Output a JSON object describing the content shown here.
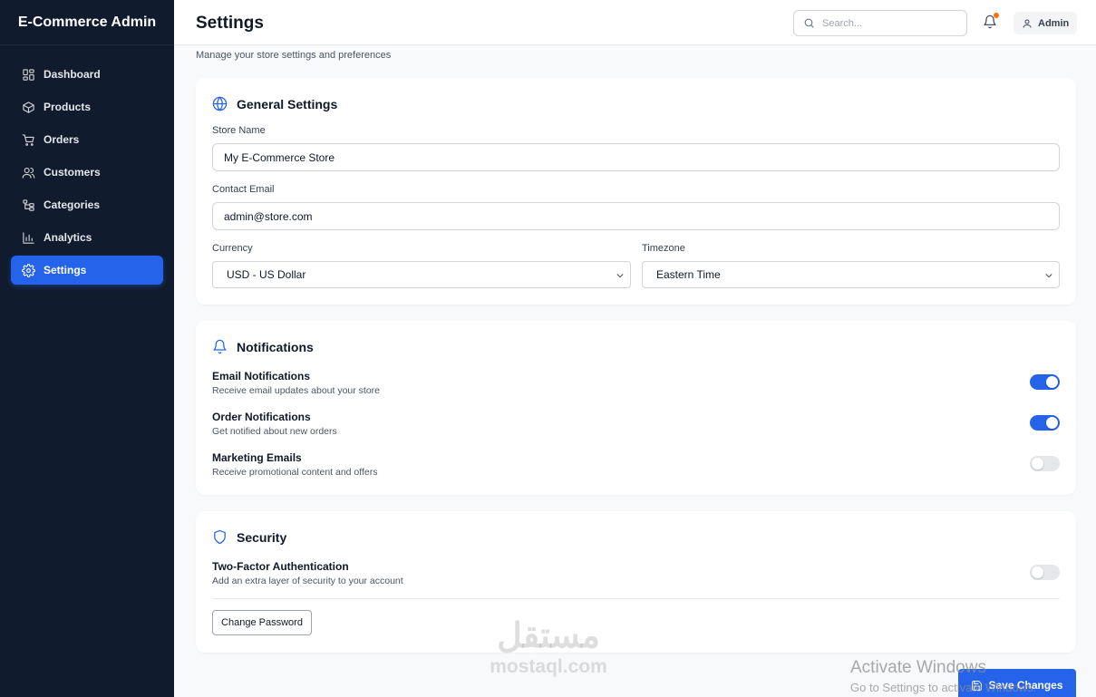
{
  "sidebar": {
    "brand": "E-Commerce Admin",
    "items": [
      {
        "label": "Dashboard",
        "icon": "grid-icon"
      },
      {
        "label": "Products",
        "icon": "box-icon"
      },
      {
        "label": "Orders",
        "icon": "cart-icon"
      },
      {
        "label": "Customers",
        "icon": "users-icon"
      },
      {
        "label": "Categories",
        "icon": "tree-icon"
      },
      {
        "label": "Analytics",
        "icon": "bar-chart-icon"
      },
      {
        "label": "Settings",
        "icon": "gear-icon",
        "active": true
      }
    ]
  },
  "header": {
    "title": "Settings",
    "search_placeholder": "Search...",
    "user_label": "Admin",
    "notification_dot_color": "#f97316"
  },
  "page": {
    "subtitle": "Manage your store settings and preferences"
  },
  "general": {
    "title": "General Settings",
    "store_name_label": "Store Name",
    "store_name_value": "My E-Commerce Store",
    "contact_email_label": "Contact Email",
    "contact_email_value": "admin@store.com",
    "currency_label": "Currency",
    "currency_value": "USD - US Dollar",
    "timezone_label": "Timezone",
    "timezone_value": "Eastern Time"
  },
  "notifications": {
    "title": "Notifications",
    "items": [
      {
        "title": "Email Notifications",
        "desc": "Receive email updates about your store",
        "enabled": true
      },
      {
        "title": "Order Notifications",
        "desc": "Get notified about new orders",
        "enabled": true
      },
      {
        "title": "Marketing Emails",
        "desc": "Receive promotional content and offers",
        "enabled": false
      }
    ]
  },
  "security": {
    "title": "Security",
    "two_factor_title": "Two-Factor Authentication",
    "two_factor_desc": "Add an extra layer of security to your account",
    "two_factor_enabled": false,
    "change_password_label": "Change Password"
  },
  "actions": {
    "save_label": "Save Changes"
  },
  "overlay": {
    "watermark_arabic": "مستقل",
    "watermark_latin": "mostaql.com",
    "activate_line1": "Activate Windows",
    "activate_line2": "Go to Settings to activate Windows."
  },
  "colors": {
    "sidebar_bg": "#111b2e",
    "accent": "#2563eb",
    "page_bg": "#f8f9fb"
  }
}
